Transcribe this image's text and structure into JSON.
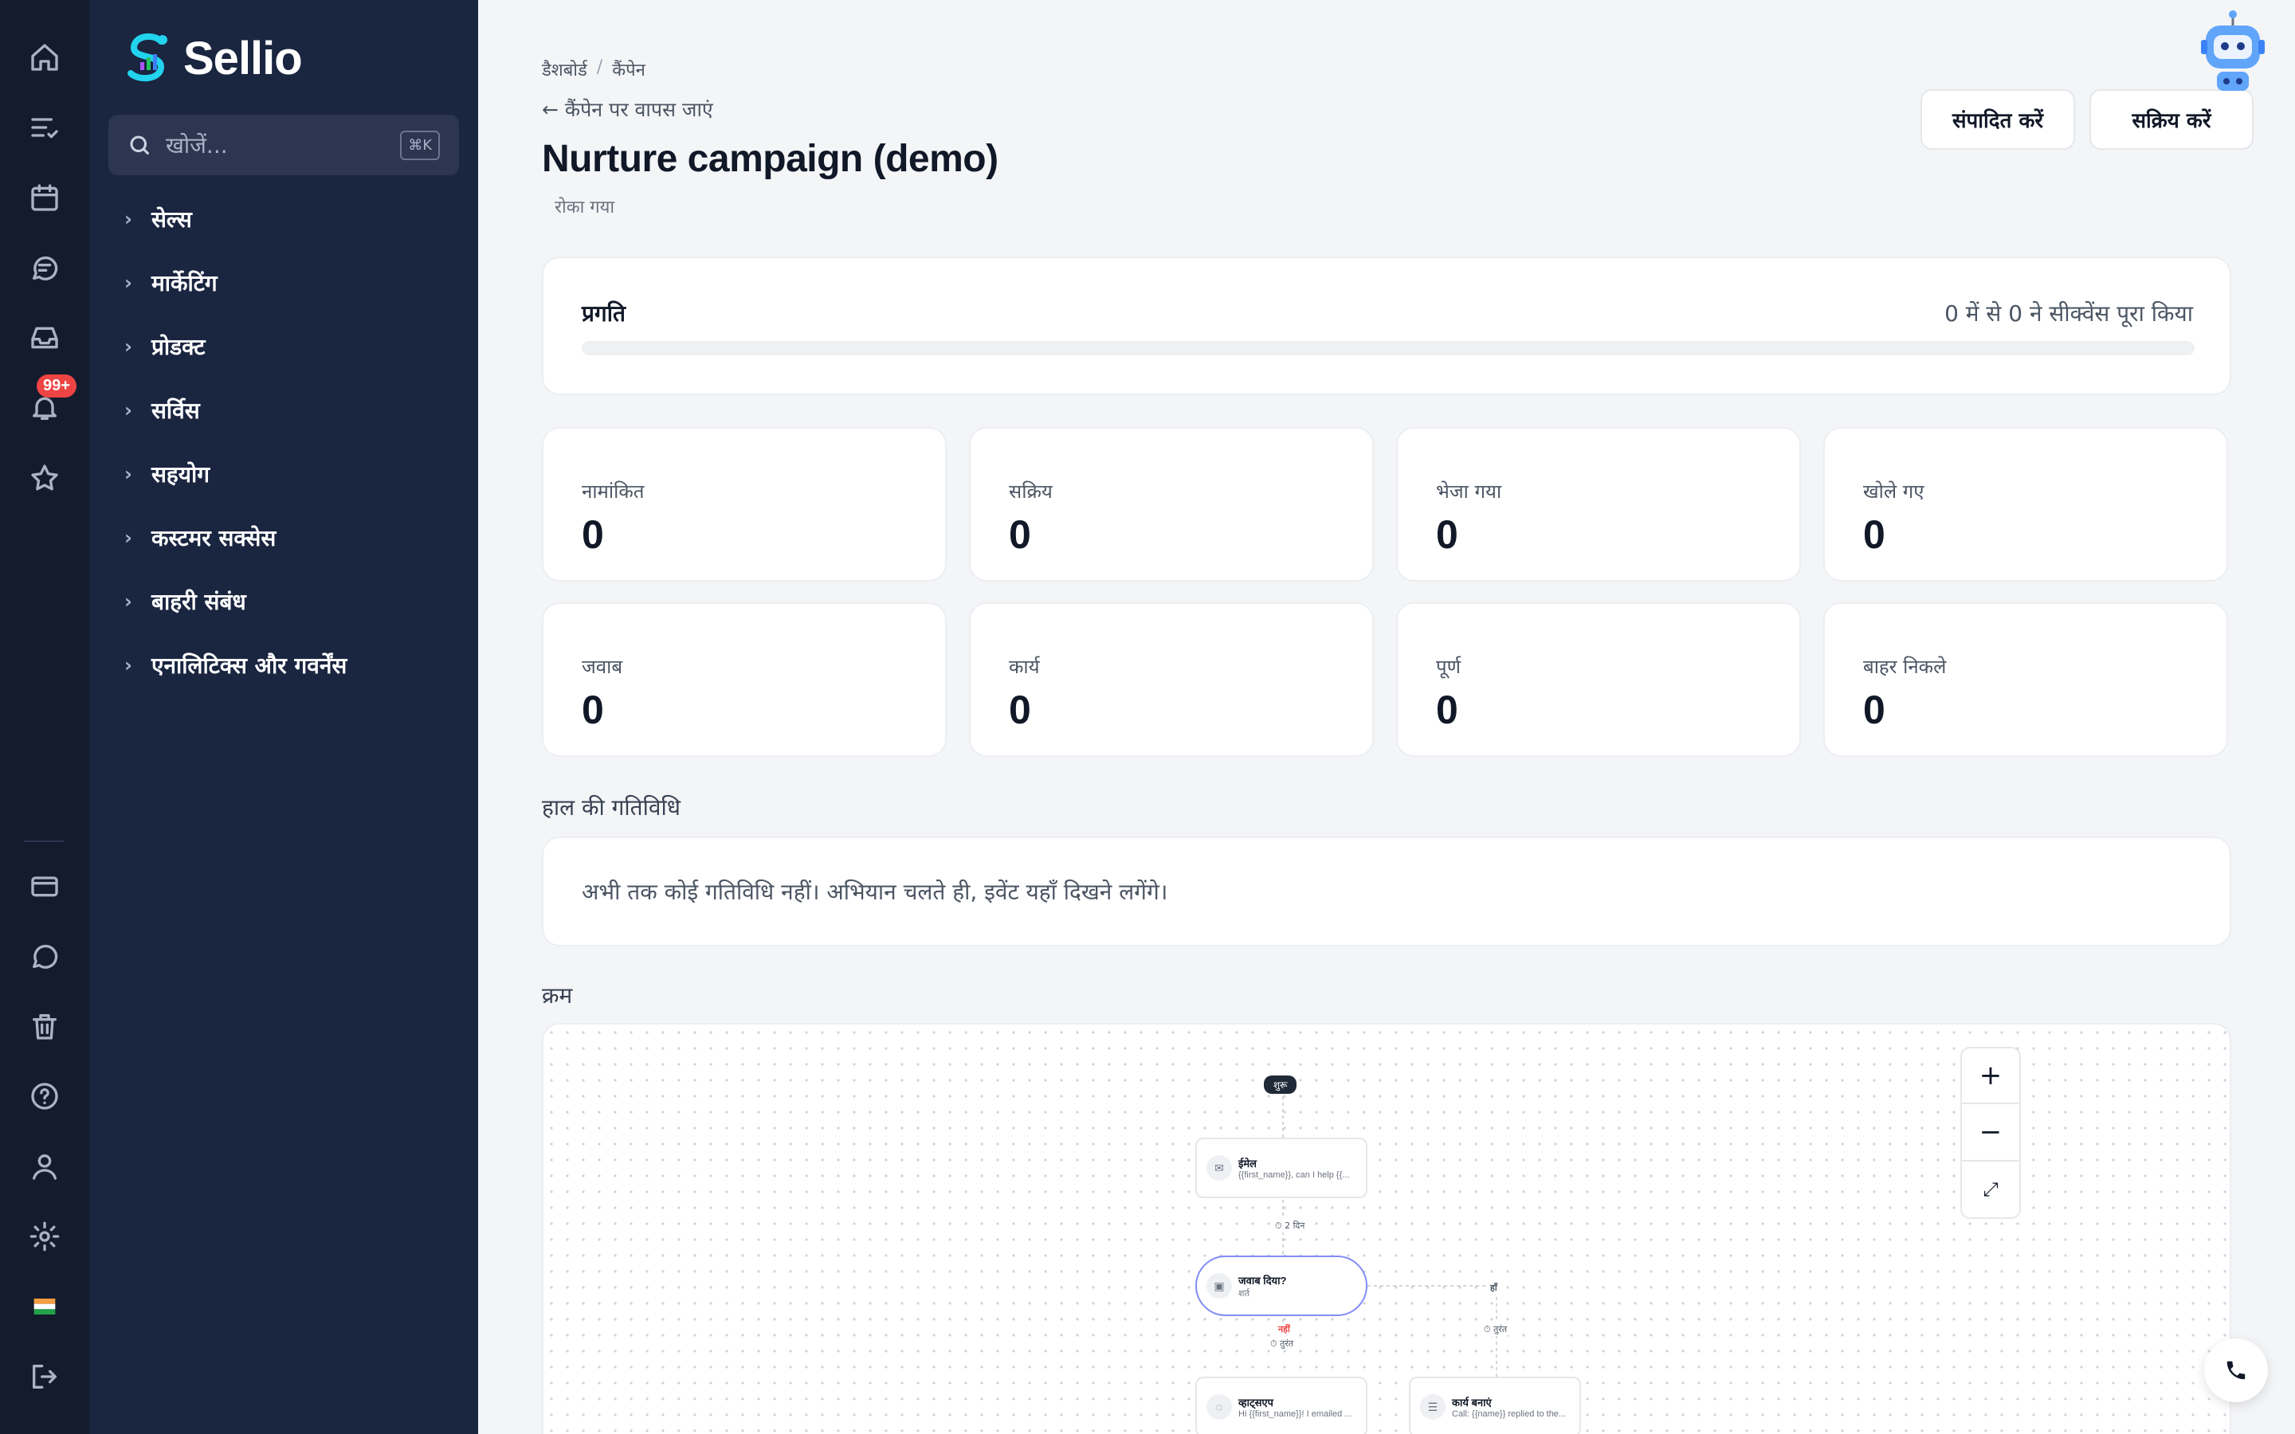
{
  "rail": {
    "notification_badge": "99+"
  },
  "sidebar": {
    "brand": "Sellio",
    "search_placeholder": "खोजें...",
    "search_shortcut": "⌘K",
    "items": [
      {
        "label": "सेल्स"
      },
      {
        "label": "मार्केटिंग"
      },
      {
        "label": "प्रोडक्ट"
      },
      {
        "label": "सर्विस"
      },
      {
        "label": "सहयोग"
      },
      {
        "label": "कस्टमर सक्सेस"
      },
      {
        "label": "बाहरी संबंध"
      },
      {
        "label": "एनालिटिक्स और गवर्नेंस"
      }
    ]
  },
  "header": {
    "breadcrumb": [
      "डैशबोर्ड",
      "कैंपेन"
    ],
    "back_label": "← कैंपेन पर वापस जाएं",
    "title": "Nurture campaign (demo)",
    "status": "रोका गया",
    "edit_label": "संपादित करें",
    "activate_label": "सक्रिय करें"
  },
  "progress": {
    "label": "प्रगति",
    "count_text": "0 में से 0 ने सीक्वेंस पूरा किया",
    "fraction": 0
  },
  "stats": [
    {
      "label": "नामांकित",
      "value": "0"
    },
    {
      "label": "सक्रिय",
      "value": "0"
    },
    {
      "label": "भेजा गया",
      "value": "0"
    },
    {
      "label": "खोले गए",
      "value": "0"
    },
    {
      "label": "जवाब",
      "value": "0"
    },
    {
      "label": "कार्य",
      "value": "0"
    },
    {
      "label": "पूर्ण",
      "value": "0"
    },
    {
      "label": "बाहर निकले",
      "value": "0"
    }
  ],
  "activity": {
    "title": "हाल की गतिविधि",
    "empty_text": "अभी तक कोई गतिविधि नहीं। अभियान चलते ही, इवेंट यहाँ दिखने लगेंगे।"
  },
  "sequence": {
    "title": "क्रम",
    "start_label": "शुरू",
    "nodes": [
      {
        "title": "ईमेल",
        "subtitle": "{{first_name}}, can I help {{..."
      },
      {
        "title": "जवाब दिया?",
        "subtitle": "शर्त"
      },
      {
        "title": "व्हाट्सएप",
        "subtitle": "Hi {{first_name}}! I emailed ..."
      },
      {
        "title": "कार्य बनाएं",
        "subtitle": "Call: {{name}} replied to the..."
      }
    ],
    "delay_label": "2 दिन",
    "yes_label": "हाँ",
    "no_label": "नहीं",
    "immediate_label": "तुरंत",
    "zoom_in": "+",
    "zoom_out": "−",
    "zoom_fit": "⤢"
  }
}
